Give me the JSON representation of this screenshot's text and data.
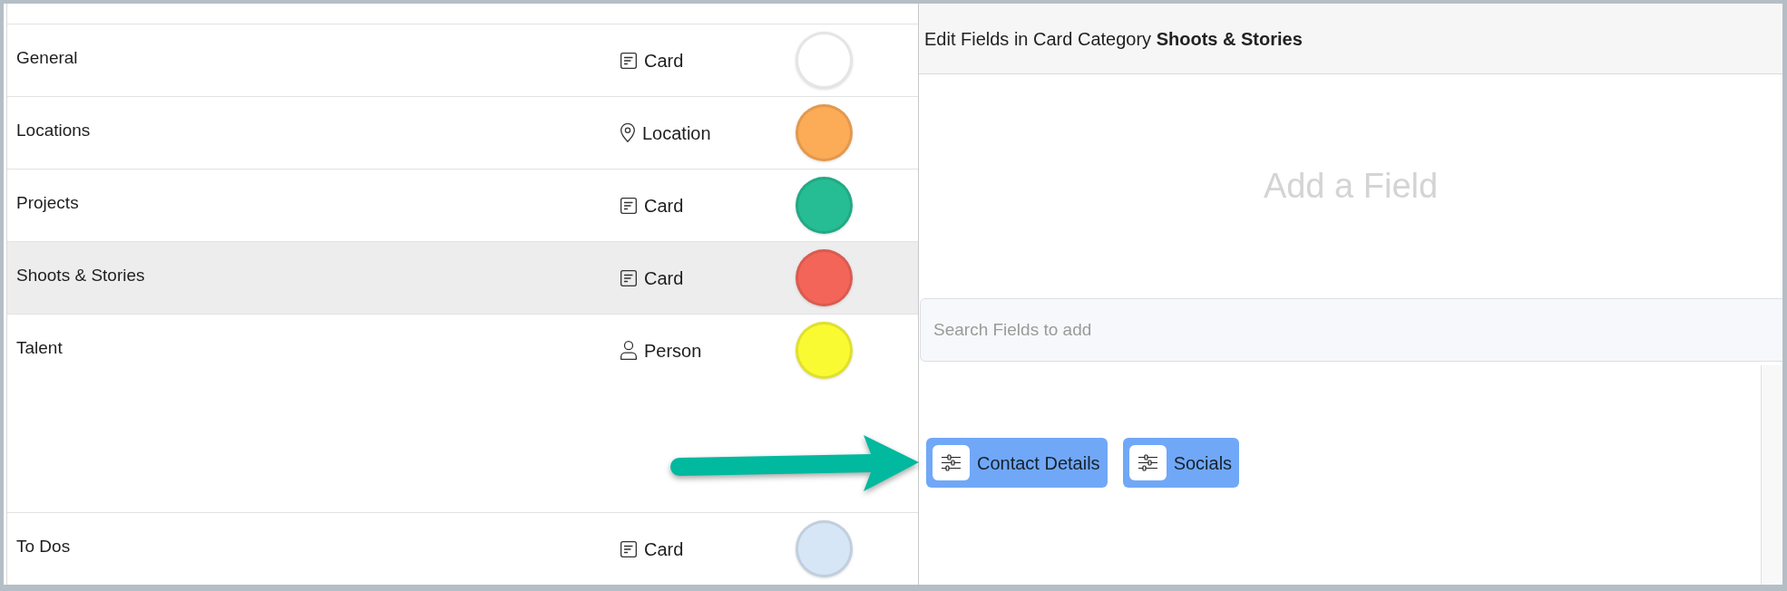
{
  "table": {
    "rows": [
      {
        "name": "General",
        "type": {
          "kind": "card",
          "label": "Card"
        },
        "color": "#ffffff",
        "selected": false
      },
      {
        "name": "Locations",
        "type": {
          "kind": "location",
          "label": "Location"
        },
        "color": "#fcab56",
        "selected": false
      },
      {
        "name": "Projects",
        "type": {
          "kind": "card",
          "label": "Card"
        },
        "color": "#26bd94",
        "selected": false
      },
      {
        "name": "Shoots & Stories",
        "type": {
          "kind": "card",
          "label": "Card"
        },
        "color": "#f46559",
        "selected": true
      },
      {
        "name": "Talent",
        "type": {
          "kind": "person",
          "label": "Person"
        },
        "color": "#fafa32",
        "selected": false
      },
      {
        "name": "To Dos",
        "type": {
          "kind": "card",
          "label": "Card"
        },
        "color": "#d7e6f6",
        "selected": false
      }
    ]
  },
  "panel": {
    "title": "Edit Fields in Card Category **Shoots & Stories**",
    "empty_hint": "Add a Field",
    "search": {
      "placeholder": "Search Fields to add"
    },
    "fields": [
      "Contact Details",
      "Socials"
    ]
  }
}
